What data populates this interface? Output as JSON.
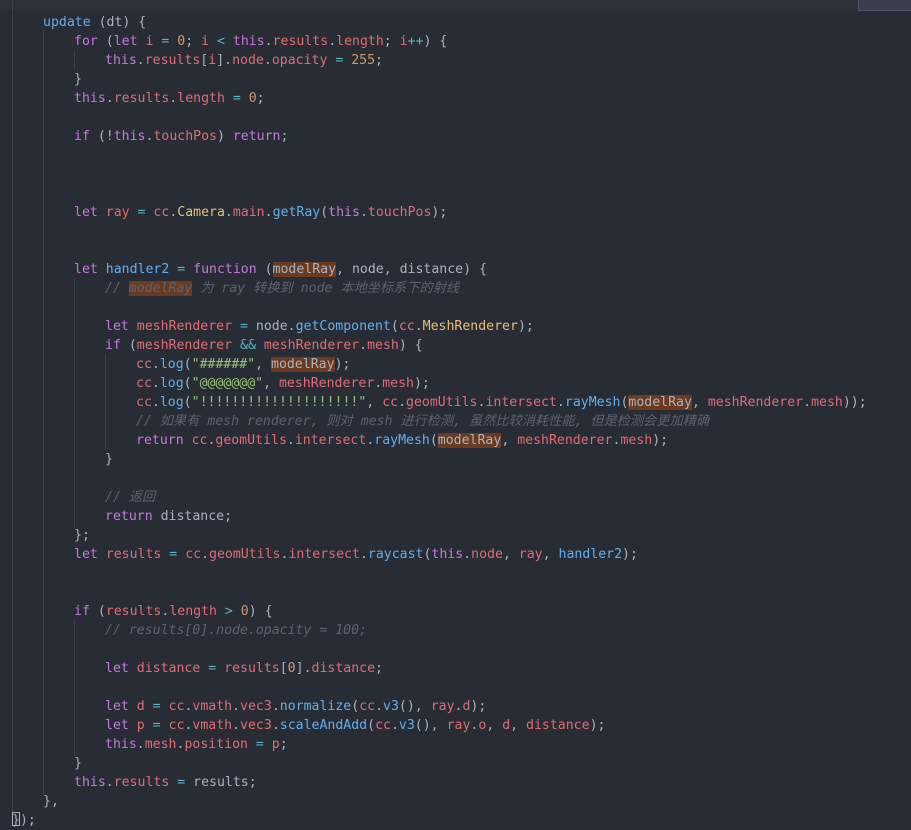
{
  "editor": {
    "language": "javascript",
    "theme_background": "#282c34",
    "highlight_word": "modelRay",
    "lines": [
      {
        "indent": 1,
        "tokens": [
          [
            "fn",
            "update"
          ],
          [
            "pl",
            " (dt) {"
          ]
        ]
      },
      {
        "indent": 2,
        "tokens": [
          [
            "kw",
            "for"
          ],
          [
            "pl",
            " ("
          ],
          [
            "kw",
            "let"
          ],
          [
            "prop",
            " i"
          ],
          [
            "op",
            " ="
          ],
          [
            "num",
            " 0"
          ],
          [
            "pl",
            "; "
          ],
          [
            "prop",
            "i"
          ],
          [
            "op",
            " <"
          ],
          [
            "kw",
            " this"
          ],
          [
            "pl",
            "."
          ],
          [
            "prop",
            "results"
          ],
          [
            "pl",
            "."
          ],
          [
            "prop",
            "length"
          ],
          [
            "pl",
            "; "
          ],
          [
            "prop",
            "i"
          ],
          [
            "op",
            "++"
          ],
          [
            "pl",
            ") {"
          ]
        ]
      },
      {
        "indent": 3,
        "tokens": [
          [
            "kw",
            "this"
          ],
          [
            "pl",
            "."
          ],
          [
            "prop",
            "results"
          ],
          [
            "pl",
            "["
          ],
          [
            "prop",
            "i"
          ],
          [
            "pl",
            "]."
          ],
          [
            "prop",
            "node"
          ],
          [
            "pl",
            "."
          ],
          [
            "prop",
            "opacity"
          ],
          [
            "op",
            " ="
          ],
          [
            "num",
            " 255"
          ],
          [
            "pl",
            ";"
          ]
        ]
      },
      {
        "indent": 2,
        "tokens": [
          [
            "pl",
            "}"
          ]
        ]
      },
      {
        "indent": 2,
        "tokens": [
          [
            "kw",
            "this"
          ],
          [
            "pl",
            "."
          ],
          [
            "prop",
            "results"
          ],
          [
            "pl",
            "."
          ],
          [
            "prop",
            "length"
          ],
          [
            "op",
            " ="
          ],
          [
            "num",
            " 0"
          ],
          [
            "pl",
            ";"
          ]
        ]
      },
      {
        "indent": 0,
        "tokens": []
      },
      {
        "indent": 2,
        "tokens": [
          [
            "kw",
            "if"
          ],
          [
            "pl",
            " (!"
          ],
          [
            "kw",
            "this"
          ],
          [
            "pl",
            "."
          ],
          [
            "prop",
            "touchPos"
          ],
          [
            "pl",
            ") "
          ],
          [
            "kw",
            "return"
          ],
          [
            "pl",
            ";"
          ]
        ]
      },
      {
        "indent": 0,
        "tokens": []
      },
      {
        "indent": 0,
        "tokens": []
      },
      {
        "indent": 0,
        "tokens": []
      },
      {
        "indent": 2,
        "tokens": [
          [
            "kw",
            "let"
          ],
          [
            "prop",
            " ray"
          ],
          [
            "op",
            " ="
          ],
          [
            "prop",
            " cc"
          ],
          [
            "pl",
            "."
          ],
          [
            "cls",
            "Camera"
          ],
          [
            "pl",
            "."
          ],
          [
            "prop",
            "main"
          ],
          [
            "pl",
            "."
          ],
          [
            "fn",
            "getRay"
          ],
          [
            "pl",
            "("
          ],
          [
            "kw",
            "this"
          ],
          [
            "pl",
            "."
          ],
          [
            "prop",
            "touchPos"
          ],
          [
            "pl",
            ");"
          ]
        ]
      },
      {
        "indent": 0,
        "tokens": []
      },
      {
        "indent": 0,
        "tokens": []
      },
      {
        "indent": 2,
        "tokens": [
          [
            "kw",
            "let"
          ],
          [
            "fn",
            " handler2"
          ],
          [
            "op",
            " ="
          ],
          [
            "kw",
            " function"
          ],
          [
            "pl",
            " ("
          ],
          [
            "hl",
            "modelRay"
          ],
          [
            "pl",
            ", node, distance) {"
          ]
        ]
      },
      {
        "indent": 3,
        "tokens": [
          [
            "cm",
            "// "
          ],
          [
            "cmhl",
            "modelRay"
          ],
          [
            "cm",
            " 为 ray 转换到 node 本地坐标系下的射线"
          ]
        ]
      },
      {
        "indent": 0,
        "tokens": []
      },
      {
        "indent": 3,
        "tokens": [
          [
            "kw",
            "let"
          ],
          [
            "prop",
            " meshRenderer"
          ],
          [
            "op",
            " ="
          ],
          [
            "pl",
            " node."
          ],
          [
            "fn",
            "getComponent"
          ],
          [
            "pl",
            "("
          ],
          [
            "prop",
            "cc"
          ],
          [
            "pl",
            "."
          ],
          [
            "cls",
            "MeshRenderer"
          ],
          [
            "pl",
            ");"
          ]
        ]
      },
      {
        "indent": 3,
        "tokens": [
          [
            "kw",
            "if"
          ],
          [
            "pl",
            " ("
          ],
          [
            "prop",
            "meshRenderer"
          ],
          [
            "op",
            " &&"
          ],
          [
            "prop",
            " meshRenderer"
          ],
          [
            "pl",
            "."
          ],
          [
            "prop",
            "mesh"
          ],
          [
            "pl",
            ") {"
          ]
        ]
      },
      {
        "indent": 4,
        "tokens": [
          [
            "prop",
            "cc"
          ],
          [
            "pl",
            "."
          ],
          [
            "fn",
            "log"
          ],
          [
            "pl",
            "("
          ],
          [
            "str",
            "\"######\""
          ],
          [
            "pl",
            ", "
          ],
          [
            "hl",
            "modelRay"
          ],
          [
            "pl",
            ");"
          ]
        ]
      },
      {
        "indent": 4,
        "tokens": [
          [
            "prop",
            "cc"
          ],
          [
            "pl",
            "."
          ],
          [
            "fn",
            "log"
          ],
          [
            "pl",
            "("
          ],
          [
            "str",
            "\"@@@@@@@\""
          ],
          [
            "pl",
            ", "
          ],
          [
            "prop",
            "meshRenderer"
          ],
          [
            "pl",
            "."
          ],
          [
            "prop",
            "mesh"
          ],
          [
            "pl",
            ");"
          ]
        ]
      },
      {
        "indent": 4,
        "tokens": [
          [
            "prop",
            "cc"
          ],
          [
            "pl",
            "."
          ],
          [
            "fn",
            "log"
          ],
          [
            "pl",
            "("
          ],
          [
            "str",
            "\"!!!!!!!!!!!!!!!!!!!!\""
          ],
          [
            "pl",
            ", "
          ],
          [
            "prop",
            "cc"
          ],
          [
            "pl",
            "."
          ],
          [
            "prop",
            "geomUtils"
          ],
          [
            "pl",
            "."
          ],
          [
            "prop",
            "intersect"
          ],
          [
            "pl",
            "."
          ],
          [
            "fn",
            "rayMesh"
          ],
          [
            "pl",
            "("
          ],
          [
            "hl",
            "modelRay"
          ],
          [
            "pl",
            ", "
          ],
          [
            "prop",
            "meshRenderer"
          ],
          [
            "pl",
            "."
          ],
          [
            "prop",
            "mesh"
          ],
          [
            "pl",
            "));"
          ]
        ]
      },
      {
        "indent": 4,
        "tokens": [
          [
            "cm",
            "// 如果有 mesh renderer, 则对 mesh 进行检测, 虽然比较消耗性能, 但是检测会更加精确"
          ]
        ]
      },
      {
        "indent": 4,
        "tokens": [
          [
            "kw",
            "return"
          ],
          [
            "prop",
            " cc"
          ],
          [
            "pl",
            "."
          ],
          [
            "prop",
            "geomUtils"
          ],
          [
            "pl",
            "."
          ],
          [
            "prop",
            "intersect"
          ],
          [
            "pl",
            "."
          ],
          [
            "fn",
            "rayMesh"
          ],
          [
            "pl",
            "("
          ],
          [
            "hl",
            "modelRay"
          ],
          [
            "pl",
            ", "
          ],
          [
            "prop",
            "meshRenderer"
          ],
          [
            "pl",
            "."
          ],
          [
            "prop",
            "mesh"
          ],
          [
            "pl",
            ");"
          ]
        ]
      },
      {
        "indent": 3,
        "tokens": [
          [
            "pl",
            "}"
          ]
        ]
      },
      {
        "indent": 0,
        "tokens": []
      },
      {
        "indent": 3,
        "tokens": [
          [
            "cm",
            "// 返回"
          ]
        ]
      },
      {
        "indent": 3,
        "tokens": [
          [
            "kw",
            "return"
          ],
          [
            "pl",
            " distance;"
          ]
        ]
      },
      {
        "indent": 2,
        "tokens": [
          [
            "pl",
            "};"
          ]
        ]
      },
      {
        "indent": 2,
        "tokens": [
          [
            "kw",
            "let"
          ],
          [
            "prop",
            " results"
          ],
          [
            "op",
            " ="
          ],
          [
            "prop",
            " cc"
          ],
          [
            "pl",
            "."
          ],
          [
            "prop",
            "geomUtils"
          ],
          [
            "pl",
            "."
          ],
          [
            "prop",
            "intersect"
          ],
          [
            "pl",
            "."
          ],
          [
            "fn",
            "raycast"
          ],
          [
            "pl",
            "("
          ],
          [
            "kw",
            "this"
          ],
          [
            "pl",
            "."
          ],
          [
            "prop",
            "node"
          ],
          [
            "pl",
            ", "
          ],
          [
            "prop",
            "ray"
          ],
          [
            "pl",
            ", "
          ],
          [
            "fn",
            "handler2"
          ],
          [
            "pl",
            ");"
          ]
        ]
      },
      {
        "indent": 0,
        "tokens": []
      },
      {
        "indent": 0,
        "tokens": []
      },
      {
        "indent": 2,
        "tokens": [
          [
            "kw",
            "if"
          ],
          [
            "pl",
            " ("
          ],
          [
            "prop",
            "results"
          ],
          [
            "pl",
            "."
          ],
          [
            "prop",
            "length"
          ],
          [
            "op",
            " >"
          ],
          [
            "num",
            " 0"
          ],
          [
            "pl",
            ") {"
          ]
        ]
      },
      {
        "indent": 3,
        "tokens": [
          [
            "cm",
            "// results[0].node.opacity = 100;"
          ]
        ]
      },
      {
        "indent": 0,
        "tokens": []
      },
      {
        "indent": 3,
        "tokens": [
          [
            "kw",
            "let"
          ],
          [
            "prop",
            " distance"
          ],
          [
            "op",
            " ="
          ],
          [
            "prop",
            " results"
          ],
          [
            "pl",
            "["
          ],
          [
            "num",
            "0"
          ],
          [
            "pl",
            "]."
          ],
          [
            "prop",
            "distance"
          ],
          [
            "pl",
            ";"
          ]
        ]
      },
      {
        "indent": 0,
        "tokens": []
      },
      {
        "indent": 3,
        "tokens": [
          [
            "kw",
            "let"
          ],
          [
            "prop",
            " d"
          ],
          [
            "op",
            " ="
          ],
          [
            "prop",
            " cc"
          ],
          [
            "pl",
            "."
          ],
          [
            "prop",
            "vmath"
          ],
          [
            "pl",
            "."
          ],
          [
            "prop",
            "vec3"
          ],
          [
            "pl",
            "."
          ],
          [
            "fn",
            "normalize"
          ],
          [
            "pl",
            "("
          ],
          [
            "prop",
            "cc"
          ],
          [
            "pl",
            "."
          ],
          [
            "fn",
            "v3"
          ],
          [
            "pl",
            "(), "
          ],
          [
            "prop",
            "ray"
          ],
          [
            "pl",
            "."
          ],
          [
            "prop",
            "d"
          ],
          [
            "pl",
            ");"
          ]
        ]
      },
      {
        "indent": 3,
        "tokens": [
          [
            "kw",
            "let"
          ],
          [
            "prop",
            " p"
          ],
          [
            "op",
            " ="
          ],
          [
            "prop",
            " cc"
          ],
          [
            "pl",
            "."
          ],
          [
            "prop",
            "vmath"
          ],
          [
            "pl",
            "."
          ],
          [
            "prop",
            "vec3"
          ],
          [
            "pl",
            "."
          ],
          [
            "fn",
            "scaleAndAdd"
          ],
          [
            "pl",
            "("
          ],
          [
            "prop",
            "cc"
          ],
          [
            "pl",
            "."
          ],
          [
            "fn",
            "v3"
          ],
          [
            "pl",
            "(), "
          ],
          [
            "prop",
            "ray"
          ],
          [
            "pl",
            "."
          ],
          [
            "prop",
            "o"
          ],
          [
            "pl",
            ", "
          ],
          [
            "prop",
            "d"
          ],
          [
            "pl",
            ", "
          ],
          [
            "prop",
            "distance"
          ],
          [
            "pl",
            ");"
          ]
        ]
      },
      {
        "indent": 3,
        "tokens": [
          [
            "kw",
            "this"
          ],
          [
            "pl",
            "."
          ],
          [
            "prop",
            "mesh"
          ],
          [
            "pl",
            "."
          ],
          [
            "prop",
            "position"
          ],
          [
            "op",
            " ="
          ],
          [
            "prop",
            " p"
          ],
          [
            "pl",
            ";"
          ]
        ]
      },
      {
        "indent": 2,
        "tokens": [
          [
            "pl",
            "}"
          ]
        ]
      },
      {
        "indent": 2,
        "tokens": [
          [
            "kw",
            "this"
          ],
          [
            "pl",
            "."
          ],
          [
            "prop",
            "results"
          ],
          [
            "op",
            " ="
          ],
          [
            "pl",
            " results;"
          ]
        ]
      },
      {
        "indent": 1,
        "tokens": [
          [
            "pl",
            "},"
          ]
        ]
      },
      {
        "indent": 0,
        "tokens": [
          [
            "pl",
            "});"
          ]
        ]
      }
    ]
  }
}
